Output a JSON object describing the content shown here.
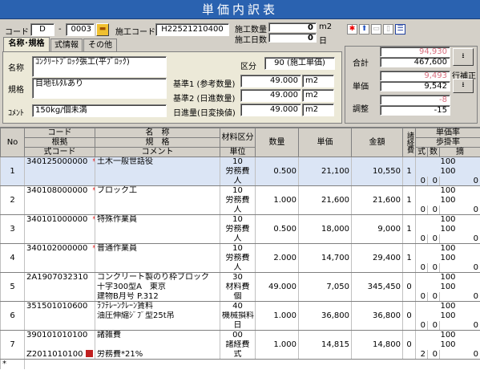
{
  "window": {
    "title": "単価内訳表"
  },
  "header": {
    "code_label": "コード",
    "code_prefix": "D",
    "code_dash": "-",
    "code_number": "0003",
    "sekou_code_label": "施工コード",
    "sekou_code_value": "H22521210400",
    "sekou_qty_label": "施工数量",
    "sekou_qty_value": "0",
    "sekou_qty_unit": "m2",
    "sekou_days_label": "施工日数",
    "sekou_days_value": "0",
    "sekou_days_unit": "日"
  },
  "tabs": [
    {
      "label": "名称･規格",
      "active": true
    },
    {
      "label": "式情報",
      "active": false
    },
    {
      "label": "その他",
      "active": false
    }
  ],
  "form": {
    "name_label": "名称",
    "name_value": "ｺﾝｸﾘｰﾄﾌﾞﾛｯｸ張工(平ﾌﾞﾛｯｸ)",
    "spec_label": "規格",
    "spec_value": "目地ﾓﾙﾀﾙあり",
    "comment_label": "ｺﾒﾝﾄ",
    "comment_value": "150kg/個未満",
    "kubun_label": "区分",
    "kubun_value": "90 (施工単価)",
    "kijun1_label": "基準1 (参考数量)",
    "kijun1_value": "49.000",
    "kijun1_unit": "m2",
    "kijun2_label": "基準2 (日進数量)",
    "kijun2_value": "49.000",
    "kijun2_unit": "m2",
    "nisshin_label": "日進量(日変換値)",
    "nisshin_value": "49.000",
    "nisshin_unit": "m2"
  },
  "summary": {
    "total_label": "合計",
    "total_upper": "94,930",
    "total_lower": "467,600",
    "unit_price_label": "単価",
    "unit_price_upper": "9,493",
    "unit_price_lower": "9,542",
    "correction_label": "行補正",
    "adjust_label": "調整",
    "adjust_upper": "-8",
    "adjust_lower": "-15"
  },
  "grid_headers": {
    "no": "No",
    "code_top": "コード",
    "code_mid": "根拠",
    "code_bot": "式コード",
    "name_top": "名　称",
    "name_mid": "規　格",
    "name_bot": "コメント",
    "material_top": "材料区分",
    "material_bot": "単位",
    "qty": "数量",
    "price": "単価",
    "amount": "金額",
    "misc": "諸経費",
    "rate_top": "単価率",
    "rate_mid": "歩掛率",
    "rate_shiki": "式",
    "rate_kazu": "数",
    "rate_tekiyo": "摘"
  },
  "rows": [
    {
      "no": "1",
      "code": "340125000000",
      "star": "*",
      "name": "土木一般世話役",
      "spec": "",
      "comment": "",
      "mat1": "10",
      "mat2": "労務費",
      "unit": "人",
      "qty": "0.500",
      "price": "21,100",
      "amount": "10,550",
      "misc": "1",
      "r1": "100",
      "r2": "100",
      "s": "0",
      "k": "0",
      "t": "0",
      "selected": true
    },
    {
      "no": "2",
      "code": "340108000000",
      "star": "*",
      "name": "ブロック工",
      "spec": "",
      "comment": "",
      "mat1": "10",
      "mat2": "労務費",
      "unit": "人",
      "qty": "1.000",
      "price": "21,600",
      "amount": "21,600",
      "misc": "1",
      "r1": "100",
      "r2": "100",
      "s": "0",
      "k": "0",
      "t": "0",
      "selected": false
    },
    {
      "no": "3",
      "code": "340101000000",
      "star": "*",
      "name": "特殊作業員",
      "spec": "",
      "comment": "",
      "mat1": "10",
      "mat2": "労務費",
      "unit": "人",
      "qty": "0.500",
      "price": "18,000",
      "amount": "9,000",
      "misc": "1",
      "r1": "100",
      "r2": "100",
      "s": "0",
      "k": "0",
      "t": "0",
      "selected": false
    },
    {
      "no": "4",
      "code": "340102000000",
      "star": "*",
      "name": "普通作業員",
      "spec": "",
      "comment": "",
      "mat1": "10",
      "mat2": "労務費",
      "unit": "人",
      "qty": "2.000",
      "price": "14,700",
      "amount": "29,400",
      "misc": "1",
      "r1": "100",
      "r2": "100",
      "s": "0",
      "k": "0",
      "t": "0",
      "selected": false
    },
    {
      "no": "5",
      "code": "2A1907032310",
      "star": "",
      "name": "コンクリート製のり枠ブロック",
      "spec": "十字300型A　東京",
      "comment": "建物B月号 P.312",
      "mat1": "30",
      "mat2": "材料費",
      "unit": "個",
      "qty": "49.000",
      "price": "7,050",
      "amount": "345,450",
      "misc": "0",
      "r1": "100",
      "r2": "100",
      "s": "0",
      "k": "0",
      "t": "0",
      "selected": false
    },
    {
      "no": "6",
      "code": "351501010600",
      "star": "",
      "name": "ﾗﾌﾃﾚｰﾝｸﾚｰﾝ賃料",
      "spec": "油圧伸縮ｼﾞﾌﾞ型25t吊",
      "comment": "",
      "mat1": "40",
      "mat2": "機械損料",
      "unit": "日",
      "qty": "1.000",
      "price": "36,800",
      "amount": "36,800",
      "misc": "0",
      "r1": "100",
      "r2": "100",
      "s": "0",
      "k": "0",
      "t": "0",
      "selected": false
    },
    {
      "no": "7",
      "code": "390101010100",
      "code2": "Z2011010100",
      "star": "",
      "name": "諸雑費",
      "spec": "",
      "comment": "労務費*21%",
      "mat1": "00",
      "mat2": "諸経費",
      "unit": "式",
      "qty": "1.000",
      "price": "14,815",
      "amount": "14,800",
      "misc": "0",
      "r1": "100",
      "r2": "100",
      "s": "2",
      "k": "0",
      "t": "0",
      "selected": false
    }
  ],
  "new_row_marker": "*"
}
